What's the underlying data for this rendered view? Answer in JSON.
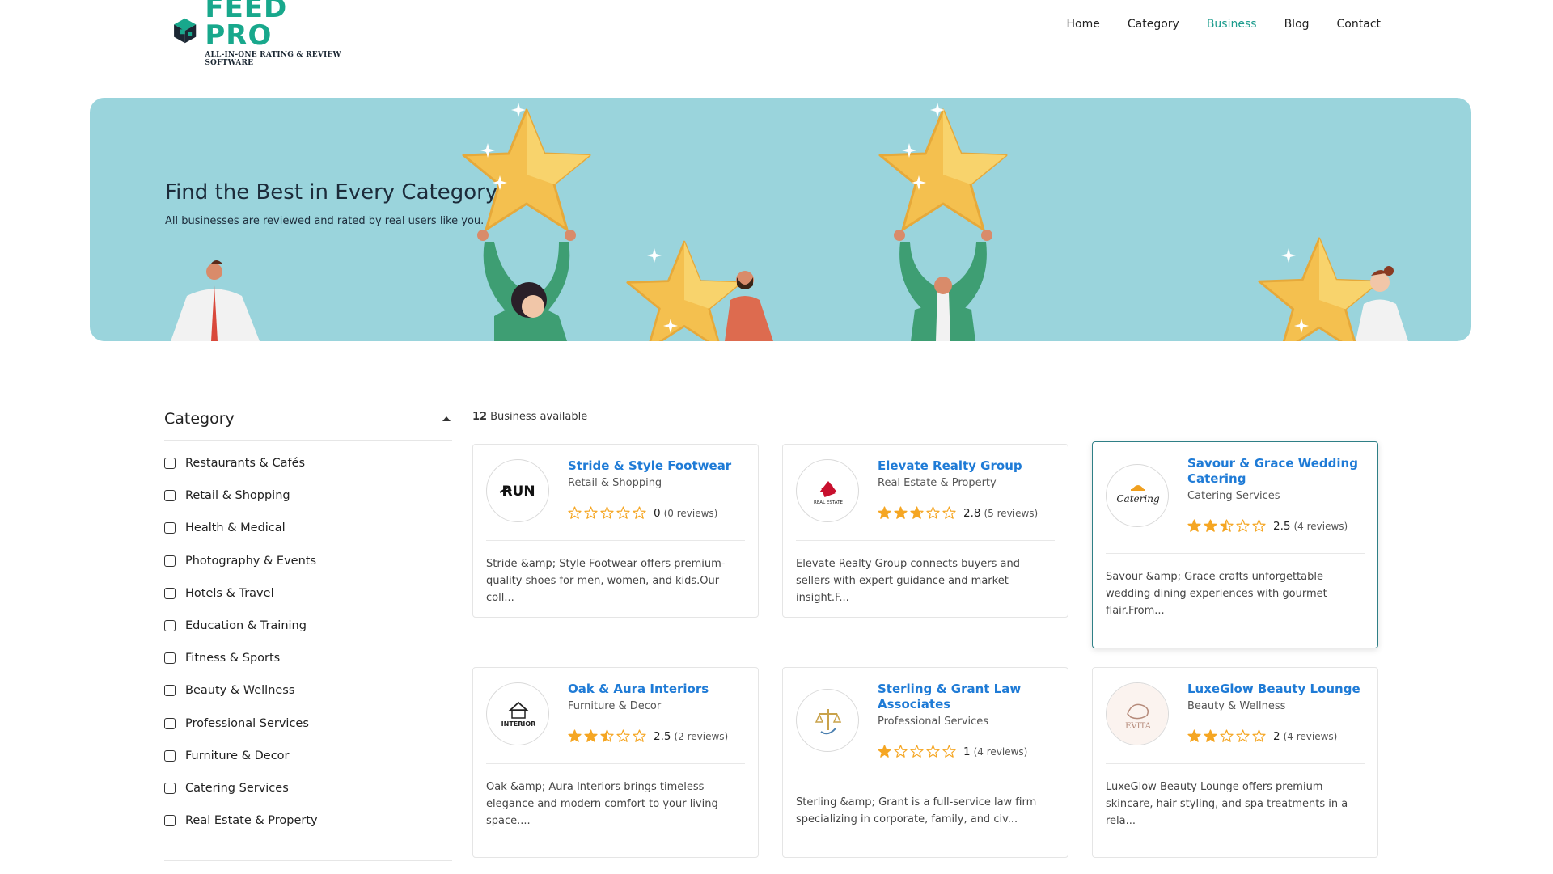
{
  "header": {
    "logo_title": "FEED PRO",
    "logo_tagline": "ALL-IN-ONE RATING & REVIEW SOFTWARE",
    "nav": [
      {
        "label": "Home",
        "active": false
      },
      {
        "label": "Category",
        "active": false
      },
      {
        "label": "Business",
        "active": true
      },
      {
        "label": "Blog",
        "active": false
      },
      {
        "label": "Contact",
        "active": false
      }
    ]
  },
  "hero": {
    "title": "Find the Best in Every Category",
    "subtitle": "All businesses are reviewed and rated by real users like you.",
    "background_color": "#9ad4dc"
  },
  "sidebar": {
    "title": "Category",
    "categories": [
      "Restaurants & Cafés",
      "Retail & Shopping",
      "Health & Medical",
      "Photography & Events",
      "Hotels & Travel",
      "Education & Training",
      "Fitness & Sports",
      "Beauty & Wellness",
      "Professional Services",
      "Furniture & Decor",
      "Catering Services",
      "Real Estate & Property"
    ]
  },
  "listing": {
    "count": "12",
    "count_label": "Business available",
    "businesses": [
      {
        "name": "Stride & Style Footwear",
        "category": "Retail & Shopping",
        "rating": 0,
        "rating_text": "0",
        "reviews": "(0 reviews)",
        "description": "Stride &amp; Style Footwear offers premium-quality shoes for men, women, and kids.Our coll...",
        "logo_text": "RUN"
      },
      {
        "name": "Elevate Realty Group",
        "category": "Real Estate & Property",
        "rating": 2.8,
        "rating_text": "2.8",
        "reviews": "(5 reviews)",
        "description": "Elevate Realty Group connects buyers and sellers with expert guidance and market insight.F...",
        "logo_text": "REAL ESTATE"
      },
      {
        "name": "Savour & Grace Wedding Catering",
        "category": "Catering Services",
        "rating": 2.5,
        "rating_text": "2.5",
        "reviews": "(4 reviews)",
        "description": "Savour &amp; Grace crafts unforgettable wedding dining experiences with gourmet flair.From...",
        "logo_text": "Catering"
      },
      {
        "name": "Oak & Aura Interiors",
        "category": "Furniture & Decor",
        "rating": 2.5,
        "rating_text": "2.5",
        "reviews": "(2 reviews)",
        "description": "Oak &amp; Aura Interiors brings timeless elegance and modern comfort to your living space....",
        "logo_text": "INTERIOR"
      },
      {
        "name": "Sterling & Grant Law Associates",
        "category": "Professional Services",
        "rating": 1,
        "rating_text": "1",
        "reviews": "(4 reviews)",
        "description": "Sterling &amp; Grant is a full-service law firm specializing in corporate, family, and civ...",
        "logo_text": ""
      },
      {
        "name": "LuxeGlow Beauty Lounge",
        "category": "Beauty & Wellness",
        "rating": 2,
        "rating_text": "2",
        "reviews": "(4 reviews)",
        "description": "LuxeGlow Beauty Lounge offers premium skincare, hair styling, and spa treatments in a rela...",
        "logo_text": "EVITA"
      }
    ]
  },
  "colors": {
    "accent": "#1c9c8d",
    "link": "#1f7bd6",
    "star": "#f5a623"
  }
}
